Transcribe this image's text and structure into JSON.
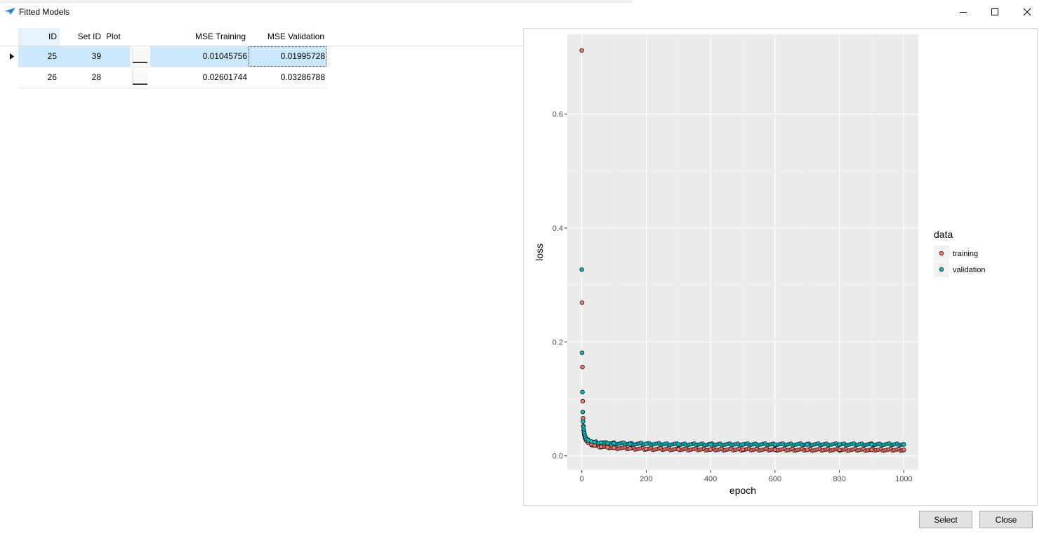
{
  "window": {
    "title": "Fitted Models"
  },
  "grid": {
    "columns": {
      "id": "ID",
      "set_id": "Set ID",
      "plot": "Plot",
      "mse_training": "MSE Training",
      "mse_validation": "MSE Validation"
    },
    "rows": [
      {
        "id": "25",
        "set_id": "39",
        "mse_training": "0.01045756",
        "mse_validation": "0.01995728",
        "selected": true
      },
      {
        "id": "26",
        "set_id": "28",
        "mse_training": "0.02601744",
        "mse_validation": "0.03286788",
        "selected": false
      }
    ]
  },
  "buttons": {
    "select": "Select",
    "close": "Close"
  },
  "chart_data": {
    "type": "scatter",
    "xlabel": "epoch",
    "ylabel": "loss",
    "xlim": [
      -45,
      1045
    ],
    "ylim": [
      -0.025,
      0.74
    ],
    "xticks": [
      0,
      200,
      400,
      600,
      800,
      1000
    ],
    "yticks": [
      0.0,
      0.2,
      0.4,
      0.6
    ],
    "xtick_labels": [
      "0",
      "200",
      "400",
      "600",
      "800",
      "1000"
    ],
    "ytick_labels": [
      "0.0",
      "0.2",
      "0.4",
      "0.6"
    ],
    "legend": {
      "title": "data",
      "placement": "right"
    },
    "series": [
      {
        "name": "training",
        "color": "#f8766d",
        "points": [
          [
            0,
            0.712
          ],
          [
            1,
            0.269
          ],
          [
            2,
            0.156
          ],
          [
            3,
            0.096
          ],
          [
            4,
            0.066
          ],
          [
            5,
            0.052
          ],
          [
            6,
            0.045
          ],
          [
            7,
            0.04
          ],
          [
            8,
            0.036
          ],
          [
            10,
            0.032
          ],
          [
            12,
            0.029
          ],
          [
            15,
            0.026
          ],
          [
            20,
            0.023
          ],
          [
            30,
            0.02
          ],
          [
            40,
            0.018
          ],
          [
            60,
            0.016
          ],
          [
            80,
            0.015
          ],
          [
            100,
            0.014
          ],
          [
            150,
            0.013
          ],
          [
            200,
            0.012
          ],
          [
            300,
            0.0115
          ],
          [
            400,
            0.011
          ],
          [
            500,
            0.011
          ],
          [
            600,
            0.0108
          ],
          [
            700,
            0.0106
          ],
          [
            800,
            0.0105
          ],
          [
            900,
            0.0105
          ],
          [
            1000,
            0.0105
          ]
        ]
      },
      {
        "name": "validation",
        "color": "#00bfc4",
        "points": [
          [
            0,
            0.327
          ],
          [
            1,
            0.181
          ],
          [
            2,
            0.112
          ],
          [
            3,
            0.077
          ],
          [
            4,
            0.06
          ],
          [
            5,
            0.051
          ],
          [
            6,
            0.046
          ],
          [
            7,
            0.042
          ],
          [
            8,
            0.039
          ],
          [
            10,
            0.035
          ],
          [
            12,
            0.032
          ],
          [
            15,
            0.029
          ],
          [
            20,
            0.027
          ],
          [
            30,
            0.025
          ],
          [
            40,
            0.024
          ],
          [
            60,
            0.023
          ],
          [
            80,
            0.022
          ],
          [
            100,
            0.022
          ],
          [
            150,
            0.021
          ],
          [
            200,
            0.021
          ],
          [
            300,
            0.02
          ],
          [
            400,
            0.02
          ],
          [
            500,
            0.02
          ],
          [
            600,
            0.02
          ],
          [
            700,
            0.02
          ],
          [
            800,
            0.02
          ],
          [
            900,
            0.02
          ],
          [
            1000,
            0.02
          ]
        ]
      }
    ]
  }
}
